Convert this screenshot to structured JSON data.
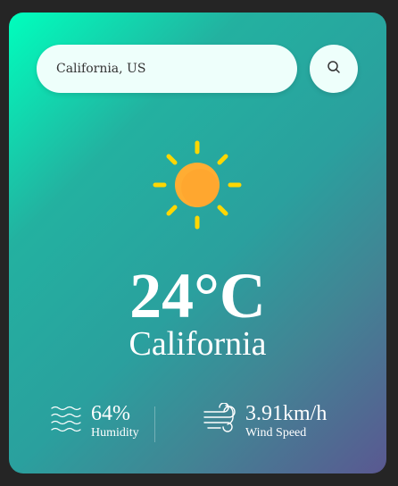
{
  "search": {
    "value": "California, US",
    "icon": "search-icon"
  },
  "weather": {
    "condition_icon": "sun-icon",
    "temperature": "24°C",
    "city": "California"
  },
  "details": {
    "humidity": {
      "value": "64%",
      "label": "Humidity",
      "icon": "humidity-waves-icon"
    },
    "wind": {
      "value": "3.91km/h",
      "label": "Wind Speed",
      "icon": "wind-icon"
    }
  },
  "colors": {
    "gradient_start": "#00ffbd",
    "gradient_end": "#5a5891",
    "sun_body": "#ffad33",
    "sun_rays": "#ffd700",
    "text": "#ffffff"
  }
}
